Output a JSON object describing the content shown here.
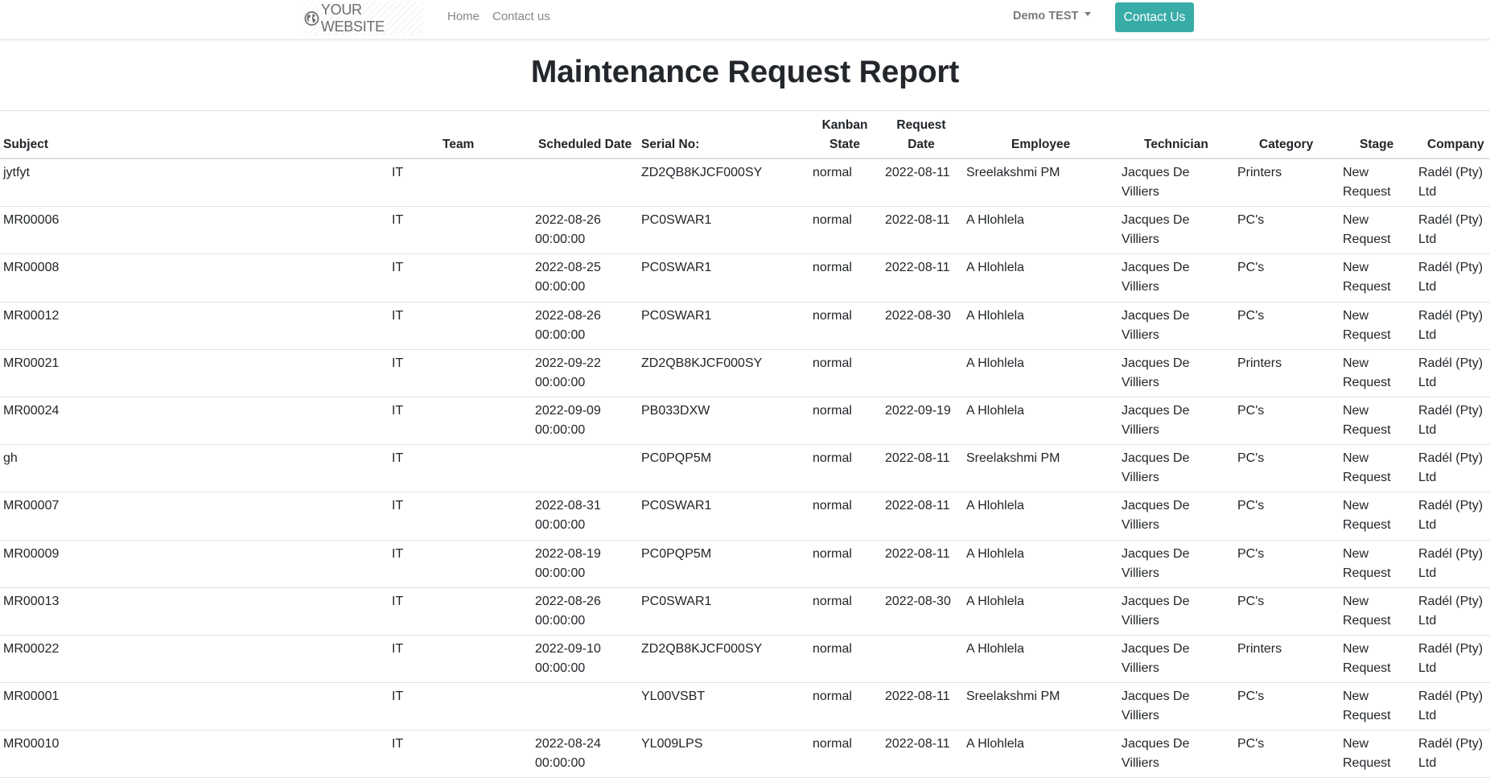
{
  "navbar": {
    "brand": "YOUR WEBSITE",
    "brand_icon": "globe-icon",
    "links": [
      "Home",
      "Contact us"
    ],
    "user_menu": "Demo TEST",
    "cta_button": "Contact Us",
    "cta_color": "#38ada8"
  },
  "page": {
    "title": "Maintenance Request Report"
  },
  "table": {
    "headers": {
      "subject": "Subject",
      "team": "Team",
      "scheduled_date": "Scheduled Date",
      "serial_no": "Serial No:",
      "kanban_state_1": "Kanban",
      "kanban_state_2": "State",
      "request_date_1": "Request",
      "request_date_2": "Date",
      "employee": "Employee",
      "technician": "Technician",
      "category": "Category",
      "stage": "Stage",
      "company": "Company"
    },
    "rows": [
      {
        "subject": "jytfyt",
        "team": "IT",
        "sched_date": "",
        "sched_time": "",
        "serial": "ZD2QB8KJCF000SY",
        "kanban": "normal",
        "request_date": "2022-08-11",
        "employee": "Sreelakshmi PM",
        "tech_1": "Jacques De",
        "tech_2": "Villiers",
        "category": "Printers",
        "stage_1": "New",
        "stage_2": "Request",
        "company_1": "Radél (Pty)",
        "company_2": "Ltd"
      },
      {
        "subject": "MR00006",
        "team": "IT",
        "sched_date": "2022-08-26",
        "sched_time": "00:00:00",
        "serial": "PC0SWAR1",
        "kanban": "normal",
        "request_date": "2022-08-11",
        "employee": "A Hlohlela",
        "tech_1": "Jacques De",
        "tech_2": "Villiers",
        "category": "PC's",
        "stage_1": "New",
        "stage_2": "Request",
        "company_1": "Radél (Pty)",
        "company_2": "Ltd"
      },
      {
        "subject": "MR00008",
        "team": "IT",
        "sched_date": "2022-08-25",
        "sched_time": "00:00:00",
        "serial": "PC0SWAR1",
        "kanban": "normal",
        "request_date": "2022-08-11",
        "employee": "A Hlohlela",
        "tech_1": "Jacques De",
        "tech_2": "Villiers",
        "category": "PC's",
        "stage_1": "New",
        "stage_2": "Request",
        "company_1": "Radél (Pty)",
        "company_2": "Ltd"
      },
      {
        "subject": "MR00012",
        "team": "IT",
        "sched_date": "2022-08-26",
        "sched_time": "00:00:00",
        "serial": "PC0SWAR1",
        "kanban": "normal",
        "request_date": "2022-08-30",
        "employee": "A Hlohlela",
        "tech_1": "Jacques De",
        "tech_2": "Villiers",
        "category": "PC's",
        "stage_1": "New",
        "stage_2": "Request",
        "company_1": "Radél (Pty)",
        "company_2": "Ltd"
      },
      {
        "subject": "MR00021",
        "team": "IT",
        "sched_date": "2022-09-22",
        "sched_time": "00:00:00",
        "serial": "ZD2QB8KJCF000SY",
        "kanban": "normal",
        "request_date": "",
        "employee": "A Hlohlela",
        "tech_1": "Jacques De",
        "tech_2": "Villiers",
        "category": "Printers",
        "stage_1": "New",
        "stage_2": "Request",
        "company_1": "Radél (Pty)",
        "company_2": "Ltd"
      },
      {
        "subject": "MR00024",
        "team": "IT",
        "sched_date": "2022-09-09",
        "sched_time": "00:00:00",
        "serial": "PB033DXW",
        "kanban": "normal",
        "request_date": "2022-09-19",
        "employee": "A Hlohlela",
        "tech_1": "Jacques De",
        "tech_2": "Villiers",
        "category": "PC's",
        "stage_1": "New",
        "stage_2": "Request",
        "company_1": "Radél (Pty)",
        "company_2": "Ltd"
      },
      {
        "subject": "gh",
        "team": "IT",
        "sched_date": "",
        "sched_time": "",
        "serial": "PC0PQP5M",
        "kanban": "normal",
        "request_date": "2022-08-11",
        "employee": "Sreelakshmi PM",
        "tech_1": "Jacques De",
        "tech_2": "Villiers",
        "category": "PC's",
        "stage_1": "New",
        "stage_2": "Request",
        "company_1": "Radél (Pty)",
        "company_2": "Ltd"
      },
      {
        "subject": "MR00007",
        "team": "IT",
        "sched_date": "2022-08-31",
        "sched_time": "00:00:00",
        "serial": "PC0SWAR1",
        "kanban": "normal",
        "request_date": "2022-08-11",
        "employee": "A Hlohlela",
        "tech_1": "Jacques De",
        "tech_2": "Villiers",
        "category": "PC's",
        "stage_1": "New",
        "stage_2": "Request",
        "company_1": "Radél (Pty)",
        "company_2": "Ltd"
      },
      {
        "subject": "MR00009",
        "team": "IT",
        "sched_date": "2022-08-19",
        "sched_time": "00:00:00",
        "serial": "PC0PQP5M",
        "kanban": "normal",
        "request_date": "2022-08-11",
        "employee": "A Hlohlela",
        "tech_1": "Jacques De",
        "tech_2": "Villiers",
        "category": "PC's",
        "stage_1": "New",
        "stage_2": "Request",
        "company_1": "Radél (Pty)",
        "company_2": "Ltd"
      },
      {
        "subject": "MR00013",
        "team": "IT",
        "sched_date": "2022-08-26",
        "sched_time": "00:00:00",
        "serial": "PC0SWAR1",
        "kanban": "normal",
        "request_date": "2022-08-30",
        "employee": "A Hlohlela",
        "tech_1": "Jacques De",
        "tech_2": "Villiers",
        "category": "PC's",
        "stage_1": "New",
        "stage_2": "Request",
        "company_1": "Radél (Pty)",
        "company_2": "Ltd"
      },
      {
        "subject": "MR00022",
        "team": "IT",
        "sched_date": "2022-09-10",
        "sched_time": "00:00:00",
        "serial": "ZD2QB8KJCF000SY",
        "kanban": "normal",
        "request_date": "",
        "employee": "A Hlohlela",
        "tech_1": "Jacques De",
        "tech_2": "Villiers",
        "category": "Printers",
        "stage_1": "New",
        "stage_2": "Request",
        "company_1": "Radél (Pty)",
        "company_2": "Ltd"
      },
      {
        "subject": "MR00001",
        "team": "IT",
        "sched_date": "",
        "sched_time": "",
        "serial": "YL00VSBT",
        "kanban": "normal",
        "request_date": "2022-08-11",
        "employee": "Sreelakshmi PM",
        "tech_1": "Jacques De",
        "tech_2": "Villiers",
        "category": "PC's",
        "stage_1": "New",
        "stage_2": "Request",
        "company_1": "Radél (Pty)",
        "company_2": "Ltd"
      },
      {
        "subject": "MR00010",
        "team": "IT",
        "sched_date": "2022-08-24",
        "sched_time": "00:00:00",
        "serial": "YL009LPS",
        "kanban": "normal",
        "request_date": "2022-08-11",
        "employee": "A Hlohlela",
        "tech_1": "Jacques De",
        "tech_2": "Villiers",
        "category": "PC's",
        "stage_1": "New",
        "stage_2": "Request",
        "company_1": "Radél (Pty)",
        "company_2": "Ltd"
      }
    ]
  }
}
